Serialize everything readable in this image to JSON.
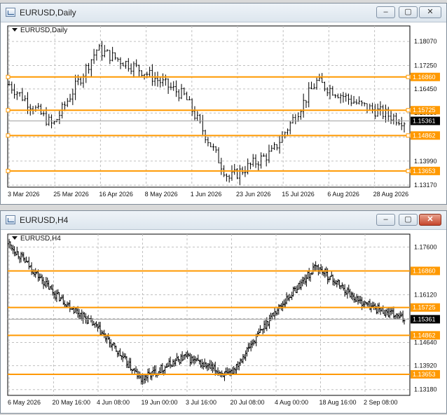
{
  "colors": {
    "level_line": "#ff9900",
    "price_bar": "#000000",
    "current_price_bg": "#000000",
    "grid": "#c0c0c0"
  },
  "levels": [
    1.1686,
    1.15725,
    1.14862,
    1.13653
  ],
  "current_price": 1.15361,
  "windows": [
    {
      "title": "EURUSD,Daily",
      "chart_label": "EURUSD,Daily",
      "icon": "chart-window-icon",
      "controls": {
        "minimize": "minimize-icon",
        "maximize": "maximize-icon",
        "close": "close-icon"
      },
      "y_ticks": [
        "1.18070",
        "1.17250",
        "1.16450",
        "1.15630",
        "1.14810",
        "1.13990",
        "1.13170"
      ],
      "level_tags": [
        "1.16860",
        "1.15725",
        "1.14862",
        "1.13653"
      ],
      "current_tag": "1.15361",
      "x_labels": [
        "3 Mar 2026",
        "25 Mar 2026",
        "16 Apr 2026",
        "8 May 2026",
        "1 Jun 2026",
        "23 Jun 2026",
        "15 Jul 2026",
        "6 Aug 2026",
        "28 Aug 2026"
      ],
      "chart_data": {
        "type": "line",
        "title": "EURUSD,Daily",
        "x": [
          "3 Mar 2026",
          "25 Mar 2026",
          "16 Apr 2026",
          "8 May 2026",
          "1 Jun 2026",
          "23 Jun 2026",
          "15 Jul 2026",
          "6 Aug 2026",
          "28 Aug 2026",
          "~Sep 2026"
        ],
        "series": [
          {
            "name": "EURUSD",
            "values": [
              1.166,
              1.152,
              1.178,
              1.171,
              1.162,
              1.134,
              1.143,
              1.167,
              1.159,
              1.1536
            ]
          }
        ],
        "ylim": [
          1.131,
          1.186
        ],
        "horizontal_levels": [
          1.1686,
          1.15725,
          1.14862,
          1.13653
        ],
        "grid": true
      }
    },
    {
      "title": "EURUSD,H4",
      "chart_label": "EURUSD,H4",
      "icon": "chart-window-icon",
      "controls": {
        "minimize": "minimize-icon",
        "maximize": "maximize-icon",
        "close": "close-icon"
      },
      "y_ticks": [
        "1.17600",
        "1.16860",
        "1.16120",
        "1.15380",
        "1.14640",
        "1.13920",
        "1.13180"
      ],
      "level_tags": [
        "1.16860",
        "1.15725",
        "1.14862",
        "1.13653"
      ],
      "current_tag": "1.15361",
      "x_labels": [
        "6 May 2026",
        "20 May 16:00",
        "4 Jun 08:00",
        "19 Jun 00:00",
        "3 Jul 16:00",
        "20 Jul 08:00",
        "4 Aug 00:00",
        "18 Aug 16:00",
        "2 Sep 08:00"
      ],
      "chart_data": {
        "type": "line",
        "title": "EURUSD,H4",
        "x": [
          "6 May 2026",
          "20 May 16:00",
          "4 Jun 08:00",
          "19 Jun 00:00",
          "3 Jul 16:00",
          "20 Jul 08:00",
          "4 Aug 00:00",
          "18 Aug 16:00",
          "2 Sep 08:00",
          "~Sep 2026"
        ],
        "series": [
          {
            "name": "EURUSD",
            "values": [
              1.177,
              1.162,
              1.151,
              1.135,
              1.142,
              1.136,
              1.155,
              1.17,
              1.159,
              1.1536
            ]
          }
        ],
        "ylim": [
          1.13,
          1.18
        ],
        "horizontal_levels": [
          1.1686,
          1.15725,
          1.14862,
          1.13653
        ],
        "grid": true
      }
    }
  ]
}
